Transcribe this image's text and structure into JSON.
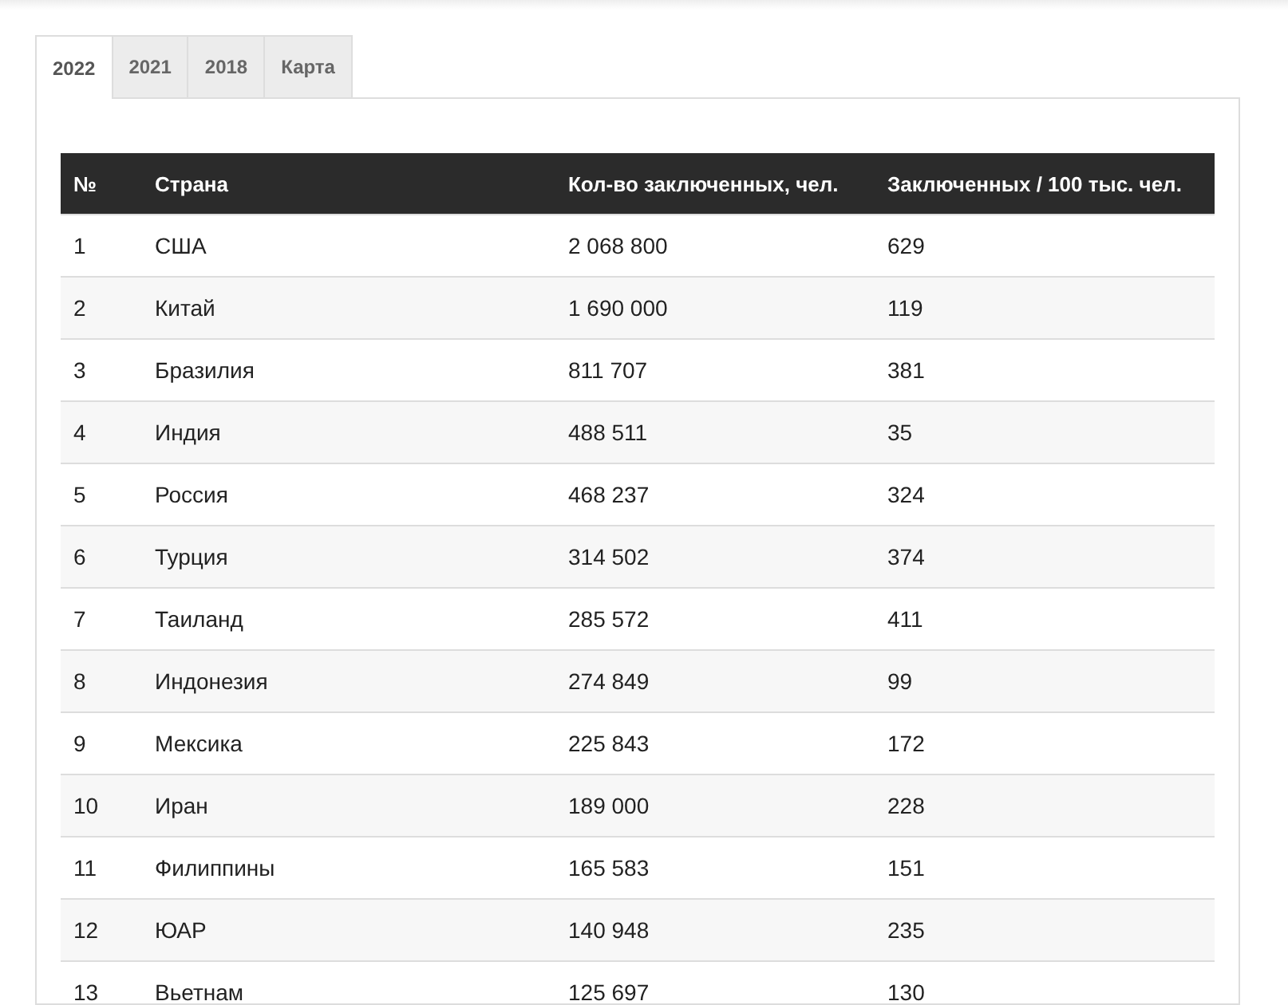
{
  "tabs": [
    {
      "label": "2022",
      "selected": true
    },
    {
      "label": "2021",
      "selected": false
    },
    {
      "label": "2018",
      "selected": false
    },
    {
      "label": "Карта",
      "selected": false
    }
  ],
  "table": {
    "columns": [
      "№",
      "Страна",
      "Кол-во заключенных, чел.",
      "Заключенных / 100 тыс. чел."
    ],
    "rows": [
      [
        "1",
        "США",
        "2 068 800",
        "629"
      ],
      [
        "2",
        "Китай",
        "1 690 000",
        "119"
      ],
      [
        "3",
        "Бразилия",
        "811 707",
        "381"
      ],
      [
        "4",
        "Индия",
        "488 511",
        "35"
      ],
      [
        "5",
        "Россия",
        "468 237",
        "324"
      ],
      [
        "6",
        "Турция",
        "314 502",
        "374"
      ],
      [
        "7",
        "Таиланд",
        "285 572",
        "411"
      ],
      [
        "8",
        "Индонезия",
        "274 849",
        "99"
      ],
      [
        "9",
        "Мексика",
        "225 843",
        "172"
      ],
      [
        "10",
        "Иран",
        "189 000",
        "228"
      ],
      [
        "11",
        "Филиппины",
        "165 583",
        "151"
      ],
      [
        "12",
        "ЮАР",
        "140 948",
        "235"
      ],
      [
        "13",
        "Вьетнам",
        "125 697",
        "130"
      ]
    ]
  }
}
